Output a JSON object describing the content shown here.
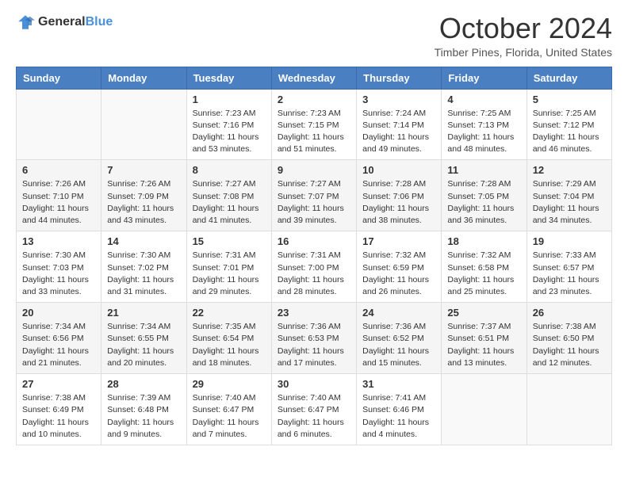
{
  "header": {
    "logo_general": "General",
    "logo_blue": "Blue",
    "main_title": "October 2024",
    "subtitle": "Timber Pines, Florida, United States"
  },
  "days_of_week": [
    "Sunday",
    "Monday",
    "Tuesday",
    "Wednesday",
    "Thursday",
    "Friday",
    "Saturday"
  ],
  "weeks": [
    [
      {
        "day": "",
        "sunrise": "",
        "sunset": "",
        "daylight": ""
      },
      {
        "day": "",
        "sunrise": "",
        "sunset": "",
        "daylight": ""
      },
      {
        "day": "1",
        "sunrise": "Sunrise: 7:23 AM",
        "sunset": "Sunset: 7:16 PM",
        "daylight": "Daylight: 11 hours and 53 minutes."
      },
      {
        "day": "2",
        "sunrise": "Sunrise: 7:23 AM",
        "sunset": "Sunset: 7:15 PM",
        "daylight": "Daylight: 11 hours and 51 minutes."
      },
      {
        "day": "3",
        "sunrise": "Sunrise: 7:24 AM",
        "sunset": "Sunset: 7:14 PM",
        "daylight": "Daylight: 11 hours and 49 minutes."
      },
      {
        "day": "4",
        "sunrise": "Sunrise: 7:25 AM",
        "sunset": "Sunset: 7:13 PM",
        "daylight": "Daylight: 11 hours and 48 minutes."
      },
      {
        "day": "5",
        "sunrise": "Sunrise: 7:25 AM",
        "sunset": "Sunset: 7:12 PM",
        "daylight": "Daylight: 11 hours and 46 minutes."
      }
    ],
    [
      {
        "day": "6",
        "sunrise": "Sunrise: 7:26 AM",
        "sunset": "Sunset: 7:10 PM",
        "daylight": "Daylight: 11 hours and 44 minutes."
      },
      {
        "day": "7",
        "sunrise": "Sunrise: 7:26 AM",
        "sunset": "Sunset: 7:09 PM",
        "daylight": "Daylight: 11 hours and 43 minutes."
      },
      {
        "day": "8",
        "sunrise": "Sunrise: 7:27 AM",
        "sunset": "Sunset: 7:08 PM",
        "daylight": "Daylight: 11 hours and 41 minutes."
      },
      {
        "day": "9",
        "sunrise": "Sunrise: 7:27 AM",
        "sunset": "Sunset: 7:07 PM",
        "daylight": "Daylight: 11 hours and 39 minutes."
      },
      {
        "day": "10",
        "sunrise": "Sunrise: 7:28 AM",
        "sunset": "Sunset: 7:06 PM",
        "daylight": "Daylight: 11 hours and 38 minutes."
      },
      {
        "day": "11",
        "sunrise": "Sunrise: 7:28 AM",
        "sunset": "Sunset: 7:05 PM",
        "daylight": "Daylight: 11 hours and 36 minutes."
      },
      {
        "day": "12",
        "sunrise": "Sunrise: 7:29 AM",
        "sunset": "Sunset: 7:04 PM",
        "daylight": "Daylight: 11 hours and 34 minutes."
      }
    ],
    [
      {
        "day": "13",
        "sunrise": "Sunrise: 7:30 AM",
        "sunset": "Sunset: 7:03 PM",
        "daylight": "Daylight: 11 hours and 33 minutes."
      },
      {
        "day": "14",
        "sunrise": "Sunrise: 7:30 AM",
        "sunset": "Sunset: 7:02 PM",
        "daylight": "Daylight: 11 hours and 31 minutes."
      },
      {
        "day": "15",
        "sunrise": "Sunrise: 7:31 AM",
        "sunset": "Sunset: 7:01 PM",
        "daylight": "Daylight: 11 hours and 29 minutes."
      },
      {
        "day": "16",
        "sunrise": "Sunrise: 7:31 AM",
        "sunset": "Sunset: 7:00 PM",
        "daylight": "Daylight: 11 hours and 28 minutes."
      },
      {
        "day": "17",
        "sunrise": "Sunrise: 7:32 AM",
        "sunset": "Sunset: 6:59 PM",
        "daylight": "Daylight: 11 hours and 26 minutes."
      },
      {
        "day": "18",
        "sunrise": "Sunrise: 7:32 AM",
        "sunset": "Sunset: 6:58 PM",
        "daylight": "Daylight: 11 hours and 25 minutes."
      },
      {
        "day": "19",
        "sunrise": "Sunrise: 7:33 AM",
        "sunset": "Sunset: 6:57 PM",
        "daylight": "Daylight: 11 hours and 23 minutes."
      }
    ],
    [
      {
        "day": "20",
        "sunrise": "Sunrise: 7:34 AM",
        "sunset": "Sunset: 6:56 PM",
        "daylight": "Daylight: 11 hours and 21 minutes."
      },
      {
        "day": "21",
        "sunrise": "Sunrise: 7:34 AM",
        "sunset": "Sunset: 6:55 PM",
        "daylight": "Daylight: 11 hours and 20 minutes."
      },
      {
        "day": "22",
        "sunrise": "Sunrise: 7:35 AM",
        "sunset": "Sunset: 6:54 PM",
        "daylight": "Daylight: 11 hours and 18 minutes."
      },
      {
        "day": "23",
        "sunrise": "Sunrise: 7:36 AM",
        "sunset": "Sunset: 6:53 PM",
        "daylight": "Daylight: 11 hours and 17 minutes."
      },
      {
        "day": "24",
        "sunrise": "Sunrise: 7:36 AM",
        "sunset": "Sunset: 6:52 PM",
        "daylight": "Daylight: 11 hours and 15 minutes."
      },
      {
        "day": "25",
        "sunrise": "Sunrise: 7:37 AM",
        "sunset": "Sunset: 6:51 PM",
        "daylight": "Daylight: 11 hours and 13 minutes."
      },
      {
        "day": "26",
        "sunrise": "Sunrise: 7:38 AM",
        "sunset": "Sunset: 6:50 PM",
        "daylight": "Daylight: 11 hours and 12 minutes."
      }
    ],
    [
      {
        "day": "27",
        "sunrise": "Sunrise: 7:38 AM",
        "sunset": "Sunset: 6:49 PM",
        "daylight": "Daylight: 11 hours and 10 minutes."
      },
      {
        "day": "28",
        "sunrise": "Sunrise: 7:39 AM",
        "sunset": "Sunset: 6:48 PM",
        "daylight": "Daylight: 11 hours and 9 minutes."
      },
      {
        "day": "29",
        "sunrise": "Sunrise: 7:40 AM",
        "sunset": "Sunset: 6:47 PM",
        "daylight": "Daylight: 11 hours and 7 minutes."
      },
      {
        "day": "30",
        "sunrise": "Sunrise: 7:40 AM",
        "sunset": "Sunset: 6:47 PM",
        "daylight": "Daylight: 11 hours and 6 minutes."
      },
      {
        "day": "31",
        "sunrise": "Sunrise: 7:41 AM",
        "sunset": "Sunset: 6:46 PM",
        "daylight": "Daylight: 11 hours and 4 minutes."
      },
      {
        "day": "",
        "sunrise": "",
        "sunset": "",
        "daylight": ""
      },
      {
        "day": "",
        "sunrise": "",
        "sunset": "",
        "daylight": ""
      }
    ]
  ]
}
